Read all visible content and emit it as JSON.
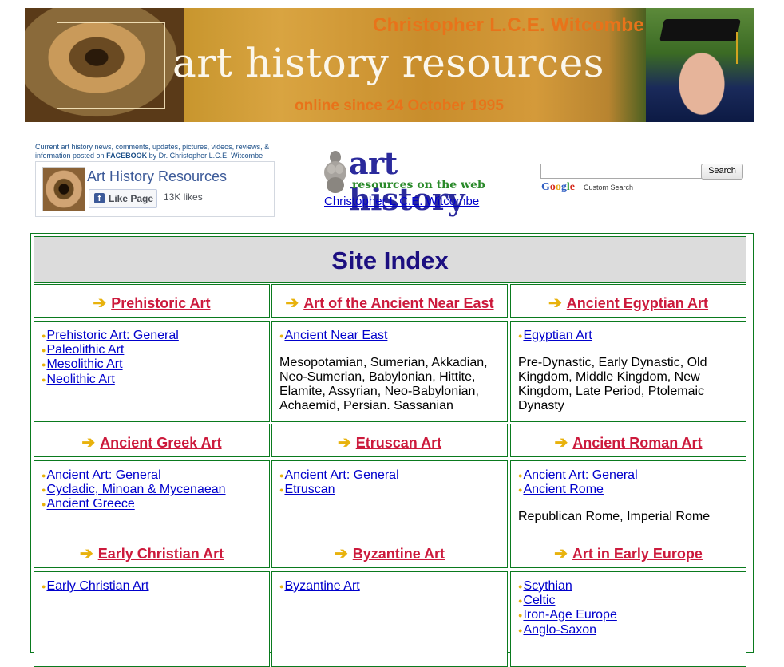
{
  "banner": {
    "name": "Christopher L.C.E. Witcombe",
    "title": "art history resources",
    "online": "online since 24 October 1995"
  },
  "facebook": {
    "note_prefix": "Current art history news, comments, updates, pictures, videos, reviews, & information posted on",
    "note_bold": "FACEBOOK",
    "note_suffix": "by Dr. Christopher L.C.E. Witcombe",
    "page_name": "Art History Resources",
    "like_label": "Like Page",
    "likes": "13K likes"
  },
  "logo": {
    "main": "art history",
    "sub": "resources on the web",
    "author_link": "Christopher L.C.E. Witcombe"
  },
  "search": {
    "value": "",
    "button": "Search",
    "custom_search": "Custom Search"
  },
  "index": {
    "title": "Site Index",
    "rows": [
      {
        "cats": [
          {
            "label": "Prehistoric Art",
            "links": [
              "Prehistoric Art: General",
              "Paleolithic Art",
              "Mesolithic Art",
              "Neolithic Art"
            ],
            "desc": ""
          },
          {
            "label": "Art of the Ancient Near East",
            "links": [
              "Ancient Near East"
            ],
            "desc": "Mesopotamian, Sumerian, Akkadian, Neo-Sumerian, Babylonian, Hittite, Elamite, Assyrian, Neo-Babylonian, Achaemid, Persian. Sassanian"
          },
          {
            "label": "Ancient Egyptian Art",
            "links": [
              "Egyptian Art"
            ],
            "desc": "Pre-Dynastic, Early Dynastic, Old Kingdom, Middle Kingdom, New Kingdom, Late Period, Ptolemaic Dynasty"
          }
        ]
      },
      {
        "cats": [
          {
            "label": "Ancient Greek Art",
            "links": [
              "Ancient Art: General",
              "Cycladic, Minoan & Mycenaean",
              "Ancient Greece"
            ],
            "desc": ""
          },
          {
            "label": "Etruscan Art",
            "links": [
              "Ancient Art: General",
              "Etruscan"
            ],
            "desc": ""
          },
          {
            "label": "Ancient Roman Art",
            "links": [
              "Ancient Art: General",
              "Ancient Rome"
            ],
            "desc": "Republican Rome, Imperial Rome"
          }
        ]
      },
      {
        "cats": [
          {
            "label": "Early Christian Art",
            "links": [
              "Early Christian Art"
            ],
            "desc": ""
          },
          {
            "label": "Byzantine Art",
            "links": [
              "Byzantine Art"
            ],
            "desc": ""
          },
          {
            "label": "Art in Early Europe",
            "links": [
              "Scythian",
              "Celtic",
              "Iron-Age Europe",
              "Anglo-Saxon"
            ],
            "desc": ""
          }
        ]
      }
    ]
  },
  "colors": {
    "banner_orange": "#e8731a",
    "index_border": "#0a7a1e",
    "category_link": "#cc1a3c",
    "arrow": "#e8b20c",
    "title": "#1c0f80"
  }
}
